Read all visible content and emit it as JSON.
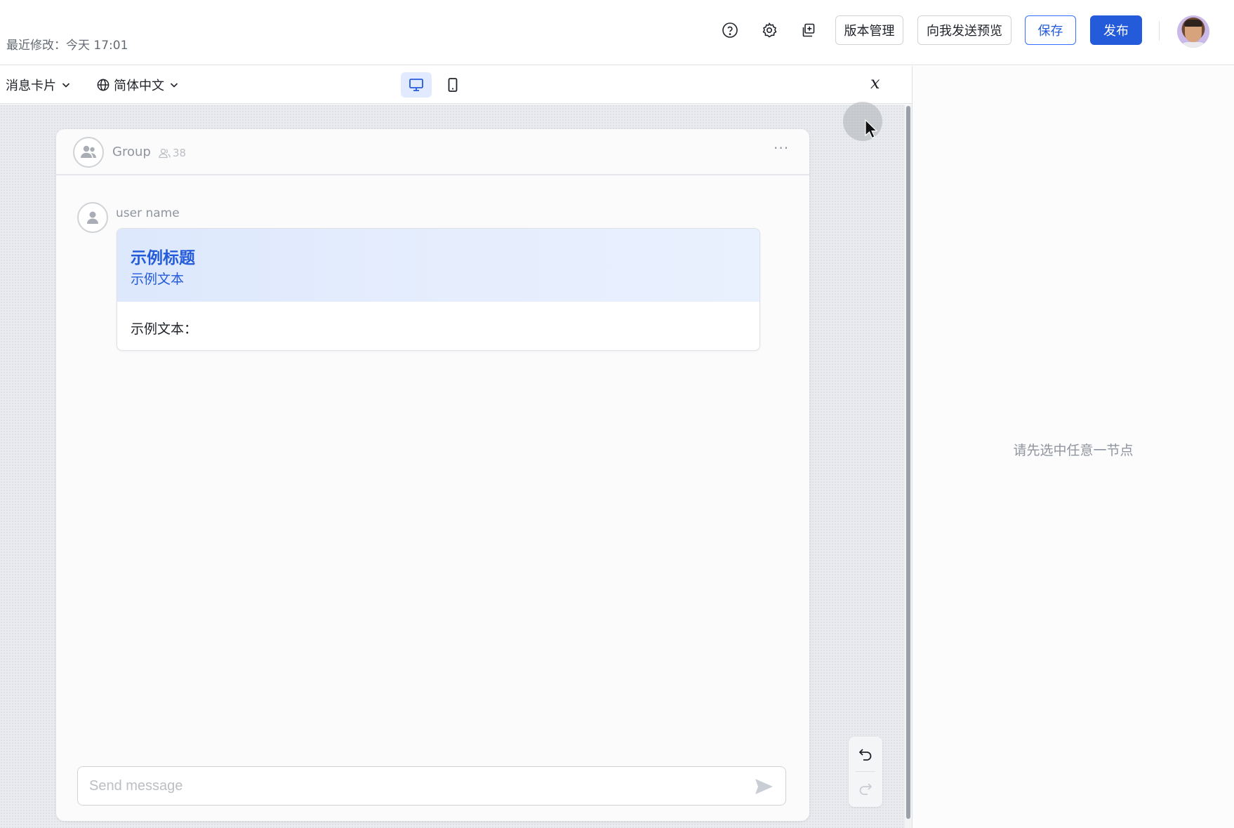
{
  "header": {
    "last_modified": "最近修改：今天 17:01",
    "buttons": {
      "version_management": "版本管理",
      "send_preview": "向我发送预览",
      "save": "保存",
      "publish": "发布"
    },
    "icons": [
      "help-icon",
      "settings-icon",
      "copy-icon"
    ]
  },
  "toolbar": {
    "card_type": "消息卡片",
    "language": "简体中文",
    "variable_symbol": "𝑥",
    "device_modes": [
      "desktop",
      "mobile"
    ],
    "active_device": "desktop"
  },
  "chat": {
    "group_name": "Group",
    "member_count": "38",
    "more": "···",
    "sender_name": "user name",
    "card": {
      "title": "示例标题",
      "subtitle": "示例文本",
      "body_text": "示例文本："
    },
    "input_placeholder": "Send message"
  },
  "right_panel": {
    "empty_hint": "请先选中任意一节点"
  },
  "colors": {
    "primary": "#245bdb",
    "card_header_bg": "#dde8fd",
    "canvas_bg": "#e9ebef"
  }
}
